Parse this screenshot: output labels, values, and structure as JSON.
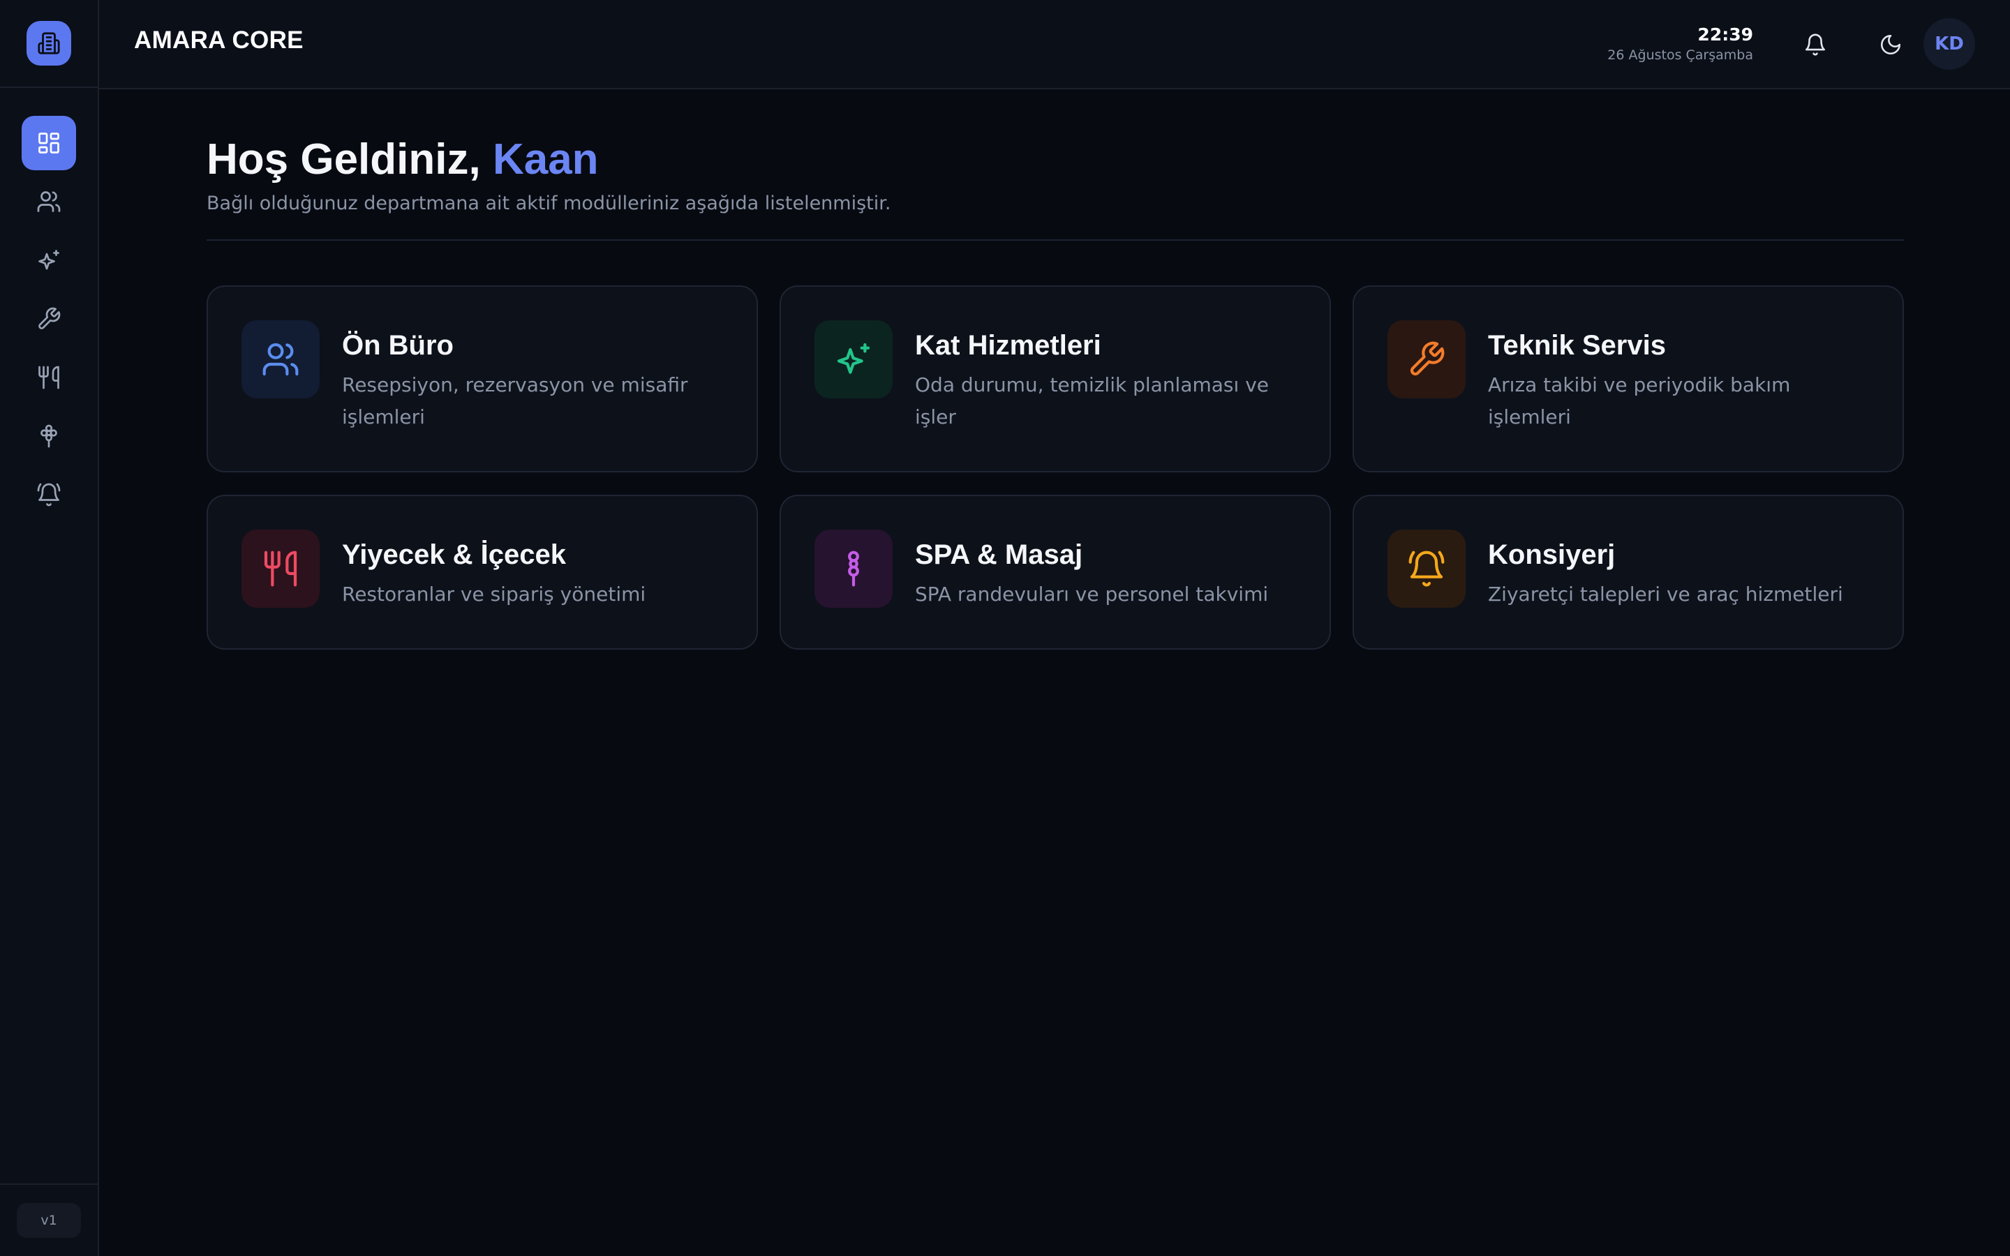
{
  "app": {
    "title": "AMARA CORE",
    "version": "v1"
  },
  "header": {
    "time": "22:39",
    "date": "26 Ağustos Çarşamba",
    "avatar_initials": "KD",
    "icons": {
      "notifications": "bell-icon",
      "theme": "moon-icon"
    }
  },
  "sidebar": {
    "items": [
      {
        "icon": "dashboard-icon",
        "active": true
      },
      {
        "icon": "users-icon",
        "active": false
      },
      {
        "icon": "sparkles-icon",
        "active": false
      },
      {
        "icon": "wrench-icon",
        "active": false
      },
      {
        "icon": "utensils-icon",
        "active": false
      },
      {
        "icon": "flower-icon",
        "active": false
      },
      {
        "icon": "bell-ring-icon",
        "active": false
      }
    ]
  },
  "welcome": {
    "greeting": "Hoş Geldiniz, ",
    "name": "Kaan",
    "subtitle": "Bağlı olduğunuz departmana ait aktif modülleriniz aşağıda listelenmiştir."
  },
  "modules": [
    {
      "title": "Ön Büro",
      "desc": "Resepsiyon, rezervasyon ve misafir işlemleri",
      "icon": "users-icon",
      "color": "#5b8def",
      "bg": "#121c33"
    },
    {
      "title": "Kat Hizmetleri",
      "desc": "Oda durumu, temizlik planlaması ve işler",
      "icon": "sparkles-icon",
      "color": "#22c58b",
      "bg": "#0c2420"
    },
    {
      "title": "Teknik Servis",
      "desc": "Arıza takibi ve periyodik bakım işlemleri",
      "icon": "wrench-icon",
      "color": "#f47c2a",
      "bg": "#2a1712"
    },
    {
      "title": "Yiyecek & İçecek",
      "desc": "Restoranlar ve sipariş yönetimi",
      "icon": "utensils-icon",
      "color": "#ef4a63",
      "bg": "#2c121c"
    },
    {
      "title": "SPA & Masaj",
      "desc": "SPA randevuları ve personel takvimi",
      "icon": "flower-icon",
      "color": "#c55ce8",
      "bg": "#26132f"
    },
    {
      "title": "Konsiyerj",
      "desc": "Ziyaretçi talepleri ve araç hizmetleri",
      "icon": "bell-ring-icon",
      "color": "#f4a81c",
      "bg": "#2a1b10"
    }
  ]
}
